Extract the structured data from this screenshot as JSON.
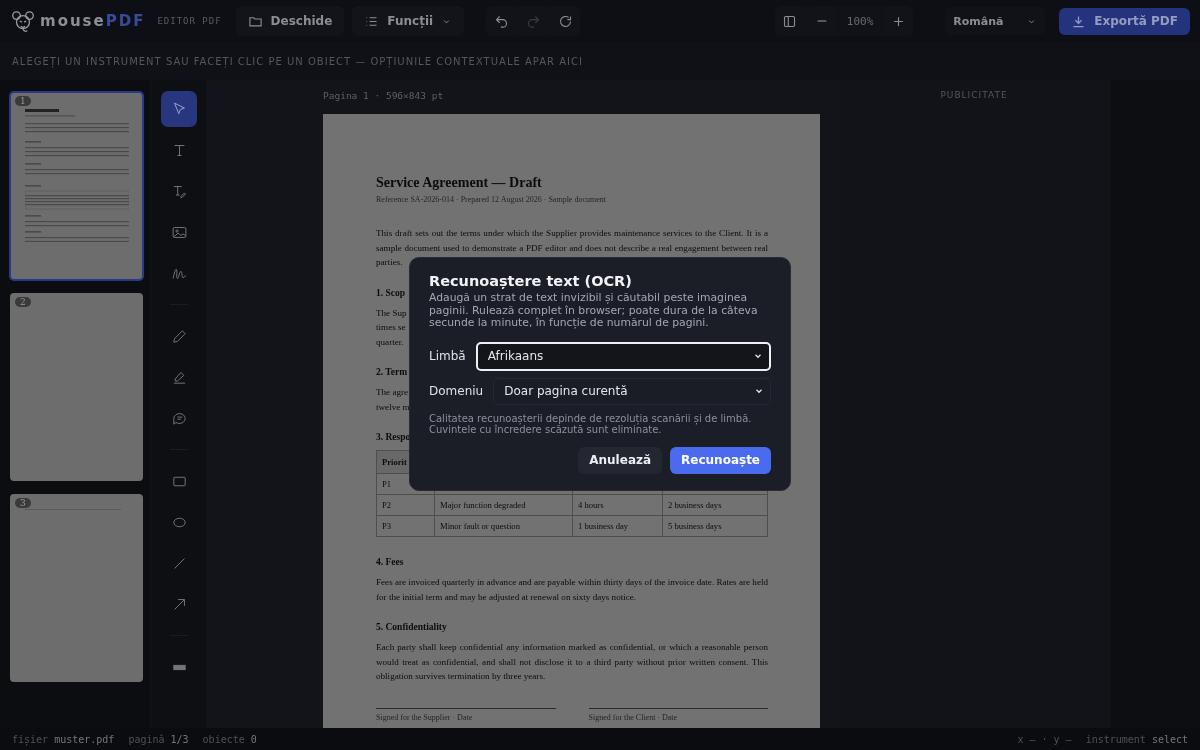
{
  "brand": {
    "name": "mouse",
    "accent": "PDF",
    "subtitle": "EDITOR PDF"
  },
  "toolbar": {
    "open": "Deschide",
    "features": "Funcții",
    "undo_disabled": false,
    "redo_disabled": true,
    "zoom": "100%",
    "language": "Română",
    "export": "Exportă PDF"
  },
  "context_hint": "ALEGEȚI UN INSTRUMENT SAU FACEȚI CLIC PE UN OBIECT — OPȚIUNILE CONTEXTUALE APAR AICI",
  "thumbnails": [
    {
      "number": "1",
      "selected": true,
      "kind": "text"
    },
    {
      "number": "2",
      "selected": false,
      "kind": "blank"
    },
    {
      "number": "3",
      "selected": false,
      "kind": "line"
    }
  ],
  "tool_groups": [
    [
      {
        "kind": "select",
        "selected": true
      },
      {
        "kind": "text",
        "selected": false
      },
      {
        "kind": "edit-text",
        "selected": false
      },
      {
        "kind": "image",
        "selected": false
      },
      {
        "kind": "signature",
        "selected": false
      }
    ],
    [
      {
        "kind": "pencil",
        "selected": false
      },
      {
        "kind": "highlighter",
        "selected": false
      },
      {
        "kind": "comment",
        "selected": false
      }
    ],
    [
      {
        "kind": "rectangle",
        "selected": false
      },
      {
        "kind": "ellipse",
        "selected": false
      },
      {
        "kind": "line",
        "selected": false
      },
      {
        "kind": "arrow",
        "selected": false
      }
    ],
    [
      {
        "kind": "redact",
        "selected": false
      }
    ]
  ],
  "page_label": "Pagina 1 · 596×843 pt",
  "document": {
    "title": "Service Agreement — Draft",
    "reference": "Reference SA-2026-014 · Prepared 12 August 2026 · Sample document",
    "blocks": [
      {
        "kind": "paragraph",
        "text": "This draft sets out the terms under which the Supplier provides maintenance services to the Client. It is a sample document used to demonstrate a PDF editor and does not describe a real engagement between real parties."
      },
      {
        "kind": "heading",
        "text": "1. Scop"
      },
      {
        "kind": "lines",
        "lines": [
          "The Sup",
          "times se",
          "quarter."
        ]
      },
      {
        "kind": "heading",
        "text": "2. Term"
      },
      {
        "kind": "lines",
        "lines": [
          "The agre",
          "twelve m"
        ]
      },
      {
        "kind": "heading",
        "text": "3. Respo"
      },
      {
        "kind": "table",
        "header": [
          "Priorit"
        ],
        "rows": [
          [
            "P1"
          ],
          [
            "P2",
            "Major function degraded",
            "4 hours",
            "2 business days"
          ],
          [
            "P3",
            "Minor fault or question",
            "1 business day",
            "5 business days"
          ]
        ]
      },
      {
        "kind": "heading",
        "text": "4. Fees"
      },
      {
        "kind": "paragraph",
        "text": "Fees are invoiced quarterly in advance and are payable within thirty days of the invoice date. Rates are held for the initial term and may be adjusted at renewal on sixty days notice."
      },
      {
        "kind": "heading",
        "text": "5. Confidentiality"
      },
      {
        "kind": "paragraph",
        "text": "Each party shall keep confidential any information marked as confidential, or which a reasonable person would treat as confidential, and shall not disclose it to a third party without prior written consent. This obligation survives termination by three years."
      },
      {
        "kind": "signatures",
        "labels": [
          "Signed for the Supplier · Date",
          "Signed for the Client · Date"
        ]
      }
    ]
  },
  "ad_label": "PUBLICITATE",
  "dialog": {
    "title": "Recunoaștere text (OCR)",
    "description": "Adaugă un strat de text invizibil și căutabil peste imaginea paginii. Rulează complet în browser; poate dura de la câteva secunde la minute, în funcție de numărul de pagini.",
    "fields": [
      {
        "label": "Limbă",
        "value": "Afrikaans",
        "focused": true
      },
      {
        "label": "Domeniu",
        "value": "Doar pagina curentă",
        "focused": false
      }
    ],
    "note": "Calitatea recunoașterii depinde de rezoluția scanării și de limbă. Cuvintele cu încredere scăzută sunt eliminate.",
    "buttons": [
      {
        "label": "Anulează",
        "kind": "secondary"
      },
      {
        "label": "Recunoaște",
        "kind": "primary"
      }
    ]
  },
  "status": {
    "items": [
      {
        "label": "fișier",
        "value": "muster.pdf"
      },
      {
        "label": "pagină",
        "value": "1/3"
      },
      {
        "label": "obiecte",
        "value": "0"
      }
    ],
    "coords": "x — · y —",
    "tool": {
      "label": "instrument",
      "value": "select"
    }
  }
}
